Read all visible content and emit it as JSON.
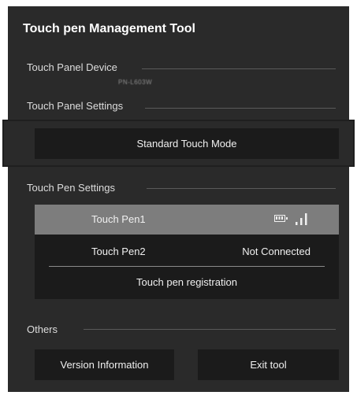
{
  "app": {
    "title": "Touch pen Management Tool"
  },
  "sections": {
    "device_label": "Touch Panel Device",
    "device_name": "PN-L603W",
    "panel_settings_label": "Touch Panel Settings",
    "pen_settings_label": "Touch Pen Settings",
    "others_label": "Others"
  },
  "panel_settings": {
    "mode_button_label": "Standard Touch Mode"
  },
  "pens": [
    {
      "name": "Touch Pen1",
      "status": "",
      "battery_icon": "battery-icon",
      "signal_icon": "signal-strength-icon",
      "selected": true
    },
    {
      "name": "Touch Pen2",
      "status": "Not Connected",
      "selected": false
    }
  ],
  "pen_registration_label": "Touch pen registration",
  "others": {
    "version_button_label": "Version Information",
    "exit_button_label": "Exit tool"
  },
  "colors": {
    "panel_background": "#2a2a2a",
    "button_background": "#1b1b1b",
    "selected_row": "#7d7d7d",
    "text": "#f0f0f0"
  }
}
